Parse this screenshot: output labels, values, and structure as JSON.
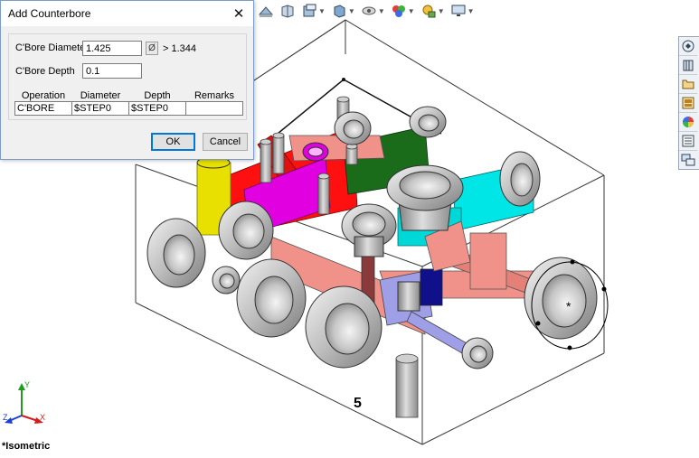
{
  "dialog": {
    "title": "Add Counterbore",
    "close_glyph": "✕",
    "cbore_diameter_label": "C'Bore Diameter",
    "cbore_diameter_value": "1.425",
    "diameter_button_glyph": "Ø",
    "min_diameter_hint": "> 1.344",
    "cbore_depth_label": "C'Bore Depth",
    "cbore_depth_value": "0.1",
    "table": {
      "headers": [
        "Operation",
        "Diameter",
        "Depth",
        "Remarks"
      ],
      "rows": [
        [
          "C'BORE",
          "$STEP0",
          "$STEP0",
          ""
        ]
      ]
    },
    "ok_label": "OK",
    "cancel_label": "Cancel"
  },
  "viewport": {
    "view_name": "*Isometric",
    "port_number": "5",
    "port_marker": "*",
    "triad": {
      "x_label": "X",
      "y_label": "Y",
      "z_label": "Z"
    }
  },
  "heads_up_toolbar": {
    "icons": [
      "section-view-icon",
      "view-orientation-icon",
      "display-style-icon",
      "hide-show-icon",
      "edit-appearance-icon",
      "apply-scene-icon",
      "view-settings-icon",
      "monitor-icon"
    ]
  },
  "task_pane": {
    "tabs": [
      "solidworks-resources-icon",
      "design-library-icon",
      "file-explorer-icon",
      "view-palette-icon",
      "appearances-icon",
      "custom-properties-icon",
      "forum-icon"
    ]
  },
  "colors": {
    "accent": "#0078d7",
    "cyan_port": "#00e5e5",
    "green_port": "#1a6b1a",
    "magenta_port": "#e000e0",
    "red_port": "#ff1010",
    "yellow_port": "#e8e000",
    "salmon_passage": "#f0928a",
    "brown_passage": "#8a3a3a",
    "lavender_passage": "#9f9fe8",
    "navy_passage": "#10108a"
  }
}
